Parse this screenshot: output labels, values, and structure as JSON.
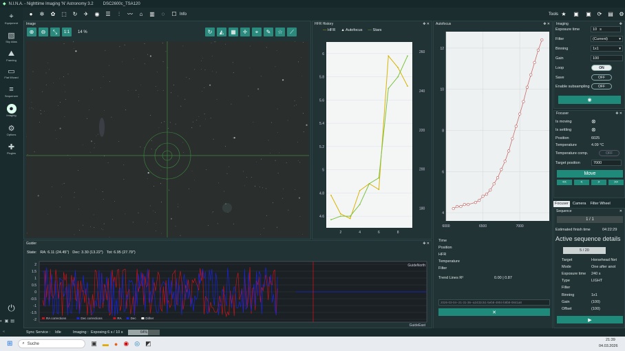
{
  "title": {
    "app": "N.I.N.A. - Nighttime Imaging 'N' Astronomy 3.2",
    "profile": "DSC2600c_TSA120"
  },
  "toolbar": {
    "info": "Info",
    "tools": "Tools"
  },
  "sidebar": {
    "items": [
      {
        "label": "Equipment",
        "icon": "telescope-icon"
      },
      {
        "label": "Sky Atlas",
        "icon": "atlas-icon"
      },
      {
        "label": "Framing",
        "icon": "framing-icon"
      },
      {
        "label": "Flat Wizard",
        "icon": "flat-icon"
      },
      {
        "label": "Sequencer",
        "icon": "sequencer-icon"
      },
      {
        "label": "Imaging",
        "icon": "imaging-icon"
      },
      {
        "label": "Options",
        "icon": "gear-icon"
      },
      {
        "label": "Plugins",
        "icon": "puzzle-icon"
      }
    ]
  },
  "image_panel": {
    "title": "Image",
    "zoom": "14 %",
    "one_to_one": "1:1"
  },
  "hfr_panel": {
    "title": "HFR History",
    "legend": [
      "HFR",
      "Autofocus",
      "Stars"
    ]
  },
  "autofocus_panel": {
    "title": "Autofocus",
    "time": "Time",
    "position": "Position",
    "hfr": "HFR",
    "temperature": "Temperature",
    "filter": "Filter",
    "trend_label": "Trend Lines R²",
    "trend_values": "0.00 | 0.87",
    "dropdown": "2026-03-04--21-31-36--a2432c51-5eb8-4904-b8b8-0841a8"
  },
  "guider_panel": {
    "title": "Guider",
    "state": "State:",
    "ra": "RA: 6.11 (24.45\")",
    "dec": "Dec: 3.30 (13.22\")",
    "tot": "Tot: 6.95 (27.79\")",
    "north": "GuideNorth",
    "east": "GuideEast",
    "legend": [
      "RA corrections",
      "Dec corrections",
      "RA",
      "Dec",
      "Dither"
    ],
    "yticks": [
      "2",
      "1.5",
      "1",
      "0.5",
      "0",
      "-0.5",
      "-1",
      "-1.5",
      "-2"
    ]
  },
  "imaging_panel": {
    "title": "Imaging",
    "exposure_time_label": "Exposure time",
    "exposure_time": "10",
    "exposure_unit": "s",
    "filter_label": "Filter",
    "filter": "(Current)",
    "binning_label": "Binning",
    "binning": "1x1",
    "gain_label": "Gain",
    "gain": "100",
    "loop_label": "Loop",
    "loop": "ON",
    "save_label": "Save",
    "save": "OFF",
    "subsampling_label": "Enable subsampling",
    "subsampling": "OFF"
  },
  "focuser_panel": {
    "title": "Focuser",
    "moving": "Is moving",
    "settling": "Is settling",
    "position_label": "Position",
    "position": "6025",
    "temp_label": "Temperature",
    "temp": "4.09 °C",
    "temp_comp_label": "Temperature comp.",
    "temp_comp": "OFF",
    "target_label": "Target position",
    "target": "7000",
    "move": "Move",
    "steps": [
      "<<",
      "<",
      ">",
      ">>"
    ]
  },
  "tabs": [
    "Focuser",
    "Camera",
    "Filter Wheel"
  ],
  "sequence_panel": {
    "title": "Sequence",
    "progress": "1 / 1",
    "finish_label": "Estimated finish time",
    "finish": "04:22:29",
    "active": "Active sequence details",
    "count": "5 / 20",
    "target_label": "Target",
    "target": "Horsehead Net",
    "mode_label": "Mode",
    "mode": "One after anot",
    "exp_label": "Exposure time",
    "exp": "240 s",
    "type_label": "Type",
    "type": "LIGHT",
    "filter_label": "Filter",
    "filter": "",
    "binning_label": "Binning",
    "binning": "1x1",
    "gain_label": "Gain",
    "gain": "(100)",
    "offset_label": "Offset",
    "offset": "(100)"
  },
  "status": {
    "sync": "Sync Service :",
    "sync_state": "Idle",
    "imaging": "Imaging :",
    "imaging_state": "Exposing 6 s / 10 s",
    "progress": "64%"
  },
  "taskbar": {
    "search": "Suche",
    "time": "21:39",
    "date": "04.03.2026"
  },
  "chart_data": [
    {
      "type": "line",
      "title": "HFR History",
      "x": [
        1,
        2,
        3,
        4,
        5,
        6,
        7,
        8,
        9
      ],
      "series": [
        {
          "name": "HFR",
          "values": [
            4.78,
            4.62,
            4.58,
            4.82,
            4.88,
            4.83,
            5.98,
            5.88,
            5.72
          ],
          "color": "#d8b400"
        },
        {
          "name": "Stars",
          "values": [
            4.57,
            4.6,
            4.6,
            4.7,
            4.88,
            4.93,
            5.7,
            5.8,
            5.98
          ],
          "color": "#7fc241"
        }
      ],
      "ylim": [
        4.5,
        6.1
      ],
      "y2lim": [
        170,
        265
      ],
      "yticks": [
        4.6,
        4.8,
        5,
        5.2,
        5.4,
        5.6,
        5.8,
        6
      ],
      "y2ticks": [
        180,
        200,
        220,
        240,
        260
      ],
      "xticks": [
        2,
        4,
        6,
        8
      ]
    },
    {
      "type": "scatter",
      "title": "Autofocus",
      "x": [
        6100,
        6150,
        6200,
        6250,
        6300,
        6400,
        6450,
        6500,
        6550,
        6600,
        6650,
        6700,
        6750,
        6800,
        6850,
        6900,
        6950,
        7000,
        7050,
        7100,
        7150,
        7200,
        7250,
        7300
      ],
      "values": [
        4.2,
        4.3,
        4.3,
        4.4,
        4.4,
        4.5,
        4.6,
        4.8,
        4.9,
        5.1,
        5.4,
        5.7,
        6.1,
        6.5,
        7.0,
        7.6,
        8.2,
        8.8,
        9.4,
        10.1,
        10.7,
        11.3,
        11.9,
        12.4
      ],
      "xlim": [
        6000,
        7400
      ],
      "ylim": [
        3.6,
        12.8
      ],
      "xticks": [
        6000,
        6500,
        7000
      ],
      "yticks": [
        4,
        6,
        8,
        10,
        12
      ]
    }
  ],
  "colors": {
    "accent": "#1f8a7a",
    "panel": "#223336",
    "bg": "#1c2d30"
  }
}
